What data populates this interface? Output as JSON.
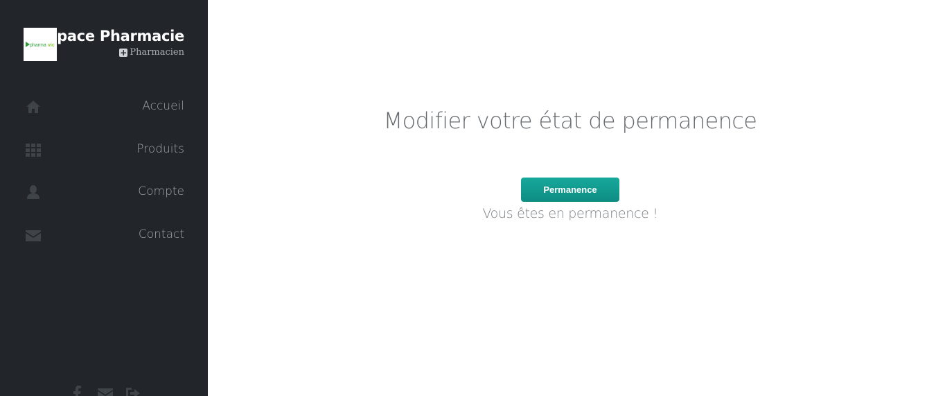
{
  "sidebar": {
    "brand_title": "Espace Pharmacie",
    "role": "Pharmacien",
    "logo_text": "pharmavic",
    "nav_items": [
      {
        "label": "Accueil",
        "icon": "home-icon"
      },
      {
        "label": "Produits",
        "icon": "grid-icon"
      },
      {
        "label": "Compte",
        "icon": "user-icon"
      },
      {
        "label": "Contact",
        "icon": "envelope-icon"
      }
    ],
    "footer_icons": [
      "facebook-icon",
      "envelope-icon",
      "sign-out-icon"
    ]
  },
  "main": {
    "title": "Modifier votre état de permanence",
    "button_label": "Permanence",
    "status_text": "Vous êtes en permanence !"
  },
  "colors": {
    "sidebar_bg": "#222529",
    "button_accent": "#119a8f",
    "icon_muted": "#3f4449"
  }
}
